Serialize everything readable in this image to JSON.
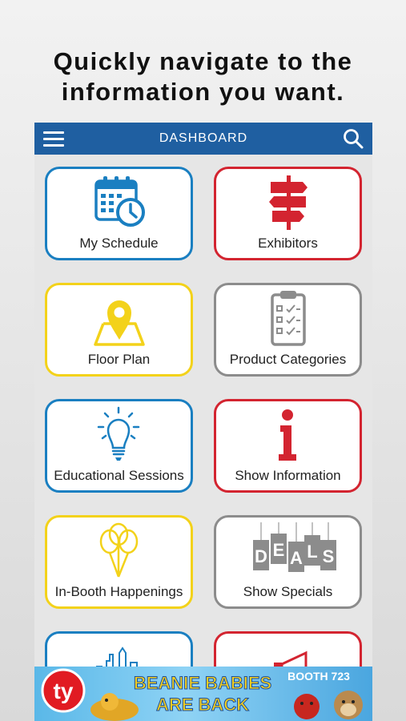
{
  "headline": {
    "line1": "Quickly navigate to the",
    "line2": "information you want."
  },
  "appbar": {
    "title": "DASHBOARD",
    "menu_icon": "hamburger-menu-icon",
    "search_icon": "search-icon",
    "color": "#1f5fa1"
  },
  "tiles": [
    {
      "label": "My Schedule",
      "icon": "calendar-clock-icon",
      "color": "#1a7fc1"
    },
    {
      "label": "Exhibitors",
      "icon": "signpost-icon",
      "color": "#d32430"
    },
    {
      "label": "Floor Plan",
      "icon": "map-pin-icon",
      "color": "#f3d21a"
    },
    {
      "label": "Product Categories",
      "icon": "clipboard-checklist-icon",
      "color": "#8c8c8c"
    },
    {
      "label": "Educational Sessions",
      "icon": "lightbulb-icon",
      "color": "#1a7fc1"
    },
    {
      "label": "Show Information",
      "icon": "info-icon",
      "color": "#d32430"
    },
    {
      "label": "In-Booth Happenings",
      "icon": "balloons-icon",
      "color": "#f3d21a"
    },
    {
      "label": "Show Specials",
      "icon": "deals-tags-icon",
      "color": "#8c8c8c"
    }
  ],
  "deals_letters": [
    "D",
    "E",
    "A",
    "L",
    "S"
  ],
  "banner": {
    "brand": "ty",
    "line1": "BEANIE BABIES",
    "line2": "ARE BACK",
    "booth": "BOOTH 723"
  }
}
